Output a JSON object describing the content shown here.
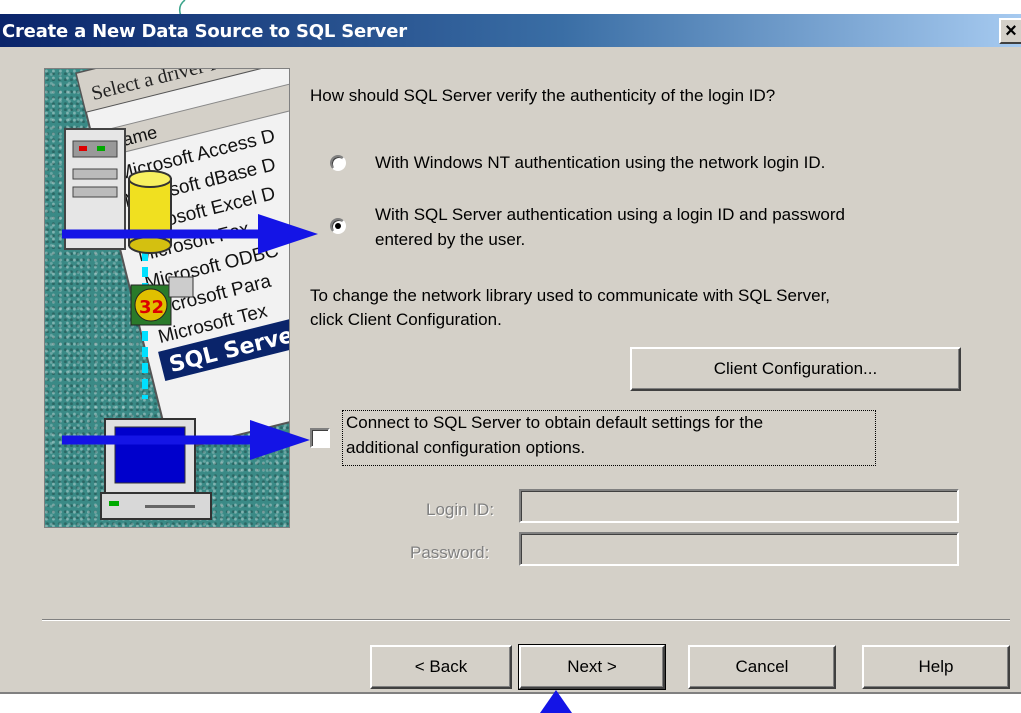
{
  "window": {
    "title": "Create a New Data Source to SQL Server",
    "close_glyph": "×"
  },
  "illustration": {
    "caption": "Select a driver for",
    "list_header": "Name",
    "drivers": [
      "Microsoft Access D",
      "Microsoft dBase D",
      "Microsoft Excel D",
      "Microsoft Fox",
      "Microsoft ODBC",
      "Microsoft Para",
      "Microsoft Tex",
      "SQL Server"
    ],
    "badge": "32"
  },
  "question": "How should SQL Server verify the authenticity of the login ID?",
  "auth_options": [
    {
      "label": "With Windows NT authentication using the network login ID.",
      "selected": false
    },
    {
      "label_line1": "With SQL Server authentication using a login ID and password",
      "label_line2": "entered by the user.",
      "selected": true
    }
  ],
  "network_note": {
    "line1": "To change the network library used to communicate with SQL Server,",
    "line2": "click Client Configuration."
  },
  "client_config_button": "Client Configuration...",
  "connect_checkbox": {
    "line1": "Connect to SQL Server to obtain default settings for the",
    "line2": "additional configuration options.",
    "checked": false
  },
  "login": {
    "login_id_label": "Login ID:",
    "login_id_value": "",
    "password_label": "Password:",
    "password_value": ""
  },
  "buttons": {
    "back": "< Back",
    "next": "Next >",
    "cancel": "Cancel",
    "help": "Help"
  },
  "colors": {
    "title_bar": "#0a246a",
    "dialog_face": "#d4d0c8",
    "annotation_arrow": "#1414e6"
  }
}
